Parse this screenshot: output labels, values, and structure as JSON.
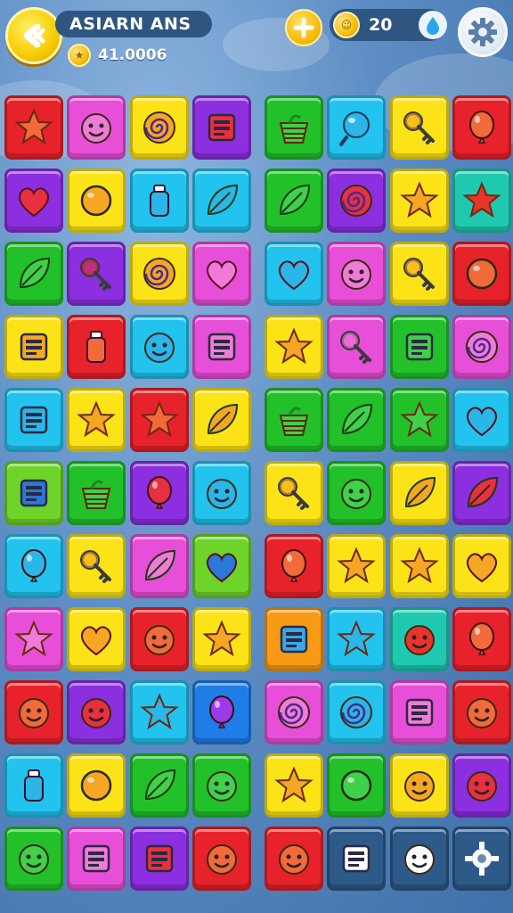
{
  "header": {
    "title": "ASIARN ANS",
    "coins": "41.0006",
    "score": "20"
  },
  "icons": {
    "back": "back-arrow-icon",
    "boost": "lightning-icon",
    "coin": "coin-icon",
    "drop": "water-drop-icon",
    "settings": "gear-icon"
  },
  "colors": {
    "red": "#e8222a",
    "pink": "#e84fd8",
    "yellow": "#fbe318",
    "purple": "#8c2fe0",
    "green": "#22c12a",
    "cyan": "#22c3ee",
    "blue": "#1f7de8",
    "orange": "#f89a16",
    "teal": "#1fc9b0",
    "lime": "#6fd42a",
    "dark": "#2e5a8a"
  },
  "board": {
    "rows": [
      [
        [
          "red",
          "star"
        ],
        [
          "pink",
          "face"
        ],
        [
          "yellow",
          "swirl"
        ],
        [
          "purple",
          "box"
        ],
        [
          "green",
          "basket"
        ],
        [
          "cyan",
          "ball"
        ],
        [
          "yellow",
          "key"
        ],
        [
          "red",
          "balloon"
        ]
      ],
      [
        [
          "purple",
          "heart"
        ],
        [
          "yellow",
          "circle"
        ],
        [
          "cyan",
          "bottle"
        ],
        [
          "cyan",
          "leaf"
        ],
        [
          "green",
          "leaf"
        ],
        [
          "purple",
          "swirl"
        ],
        [
          "yellow",
          "star"
        ],
        [
          "teal",
          "star"
        ]
      ],
      [
        [
          "green",
          "leaf"
        ],
        [
          "purple",
          "key"
        ],
        [
          "yellow",
          "swirl"
        ],
        [
          "pink",
          "heart"
        ],
        [
          "cyan",
          "heart"
        ],
        [
          "pink",
          "face"
        ],
        [
          "yellow",
          "key"
        ],
        [
          "red",
          "circle"
        ]
      ],
      [
        [
          "yellow",
          "box"
        ],
        [
          "red",
          "bottle"
        ],
        [
          "cyan",
          "face"
        ],
        [
          "pink",
          "box"
        ],
        [
          "yellow",
          "star"
        ],
        [
          "pink",
          "key"
        ],
        [
          "green",
          "box"
        ],
        [
          "pink",
          "swirl"
        ]
      ],
      [
        [
          "cyan",
          "box"
        ],
        [
          "yellow",
          "star"
        ],
        [
          "red",
          "star"
        ],
        [
          "yellow",
          "leaf"
        ],
        [
          "green",
          "basket"
        ],
        [
          "green",
          "leaf"
        ],
        [
          "green",
          "star"
        ],
        [
          "cyan",
          "heart"
        ]
      ],
      [
        [
          "lime",
          "box"
        ],
        [
          "green",
          "basket"
        ],
        [
          "purple",
          "balloon"
        ],
        [
          "cyan",
          "face"
        ],
        [
          "yellow",
          "key"
        ],
        [
          "green",
          "face"
        ],
        [
          "yellow",
          "leaf"
        ],
        [
          "purple",
          "leaf"
        ]
      ],
      [
        [
          "cyan",
          "balloon"
        ],
        [
          "yellow",
          "key"
        ],
        [
          "pink",
          "leaf"
        ],
        [
          "lime",
          "heart"
        ],
        [
          "red",
          "balloon"
        ],
        [
          "yellow",
          "star"
        ],
        [
          "yellow",
          "star"
        ],
        [
          "yellow",
          "heart"
        ]
      ],
      [
        [
          "pink",
          "star"
        ],
        [
          "yellow",
          "heart"
        ],
        [
          "red",
          "face"
        ],
        [
          "yellow",
          "star"
        ],
        [
          "orange",
          "box"
        ],
        [
          "cyan",
          "star"
        ],
        [
          "teal",
          "face"
        ],
        [
          "red",
          "balloon"
        ]
      ],
      [
        [
          "red",
          "face"
        ],
        [
          "purple",
          "face"
        ],
        [
          "cyan",
          "star"
        ],
        [
          "blue",
          "balloon"
        ],
        [
          "pink",
          "swirl"
        ],
        [
          "cyan",
          "swirl"
        ],
        [
          "pink",
          "box"
        ],
        [
          "red",
          "face"
        ]
      ],
      [
        [
          "cyan",
          "bottle"
        ],
        [
          "yellow",
          "circle"
        ],
        [
          "green",
          "leaf"
        ],
        [
          "green",
          "face"
        ],
        [
          "yellow",
          "star"
        ],
        [
          "green",
          "circle"
        ],
        [
          "yellow",
          "face"
        ],
        [
          "purple",
          "face"
        ]
      ],
      [
        [
          "green",
          "face"
        ],
        [
          "pink",
          "box"
        ],
        [
          "purple",
          "box"
        ],
        [
          "red",
          "face"
        ],
        [
          "red",
          "face"
        ],
        [
          "dark",
          "box"
        ],
        [
          "dark",
          "face"
        ],
        [
          "dark",
          "gear"
        ]
      ]
    ]
  }
}
